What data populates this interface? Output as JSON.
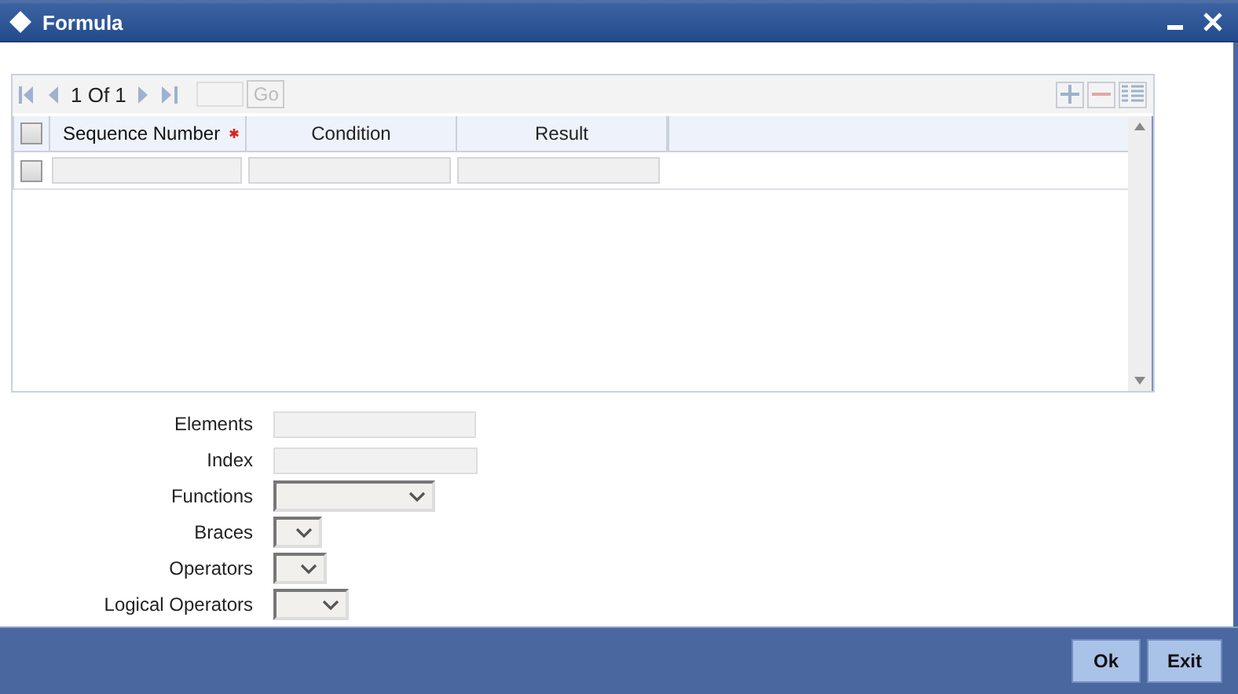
{
  "window": {
    "title": "Formula"
  },
  "pager": {
    "position": "1 Of 1",
    "go": "Go"
  },
  "table": {
    "columns": [
      {
        "label": "Sequence Number",
        "required": true
      },
      {
        "label": "Condition",
        "required": false
      },
      {
        "label": "Result",
        "required": false
      }
    ],
    "header_checked": false,
    "rows": [
      {
        "checked": false
      }
    ]
  },
  "fields": [
    {
      "label": "Elements",
      "kind": "text"
    },
    {
      "label": "Index",
      "kind": "text"
    },
    {
      "label": "Functions",
      "kind": "select"
    },
    {
      "label": "Braces",
      "kind": "select"
    },
    {
      "label": "Operators",
      "kind": "select"
    },
    {
      "label": "Logical Operators",
      "kind": "select"
    }
  ],
  "buttons": [
    "Ok",
    "Exit"
  ]
}
